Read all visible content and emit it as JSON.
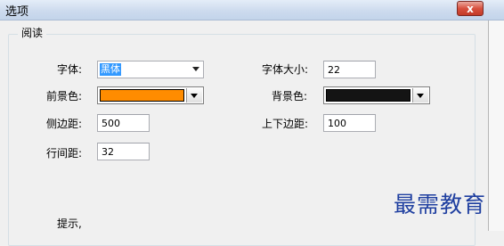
{
  "window": {
    "title": "选项",
    "close_glyph": "x"
  },
  "group": {
    "title": "阅读"
  },
  "fields": {
    "font_label": "字体:",
    "font_value": "黑体",
    "font_size_label": "字体大小:",
    "font_size_value": "22",
    "fg_label": "前景色:",
    "fg_color": "#ff8c00",
    "bg_label": "背景色:",
    "bg_color": "#141414",
    "side_margin_label": "侧边距:",
    "side_margin_value": "500",
    "tb_margin_label": "上下边距:",
    "tb_margin_value": "100",
    "line_spacing_label": "行间距:",
    "line_spacing_value": "32"
  },
  "hint": {
    "label": "提示,"
  },
  "watermark": "最需教育"
}
